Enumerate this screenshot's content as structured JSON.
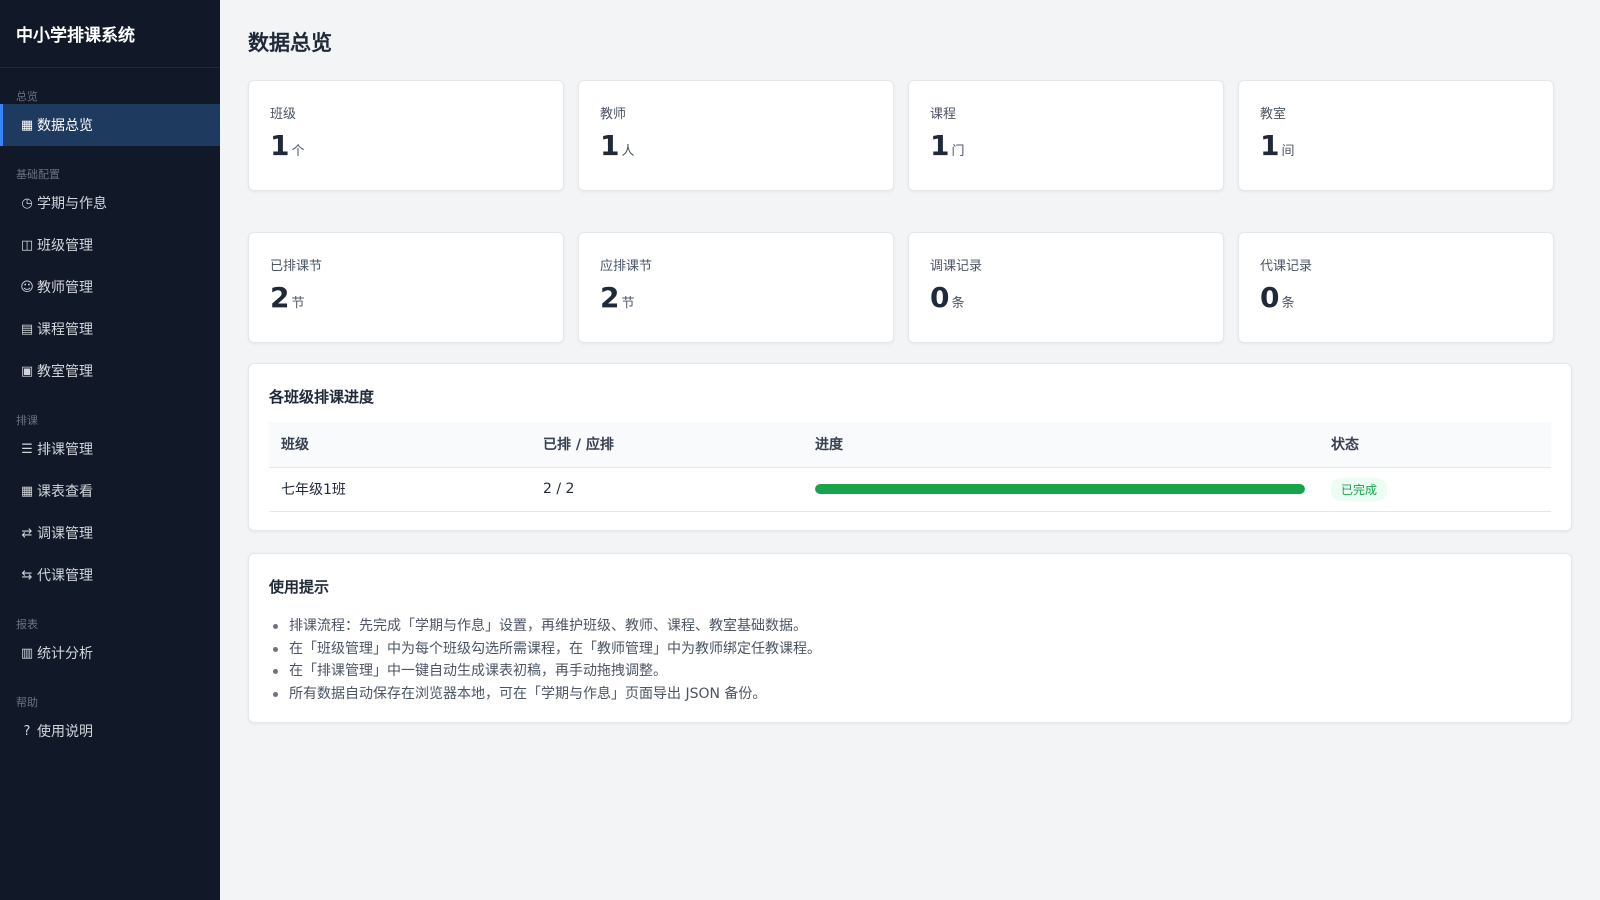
{
  "app": {
    "title": "中小学排课系统"
  },
  "sidebar": {
    "sections": [
      {
        "label": "总览",
        "items": [
          {
            "icon": "▦",
            "icon_name": "grid-icon",
            "label": "数据总览",
            "active": true
          }
        ]
      },
      {
        "label": "基础配置",
        "items": [
          {
            "icon": "◷",
            "icon_name": "clock-icon",
            "label": "学期与作息"
          },
          {
            "icon": "◫",
            "icon_name": "class-icon",
            "label": "班级管理"
          },
          {
            "icon": "☺",
            "icon_name": "teacher-icon",
            "label": "教师管理"
          },
          {
            "icon": "▤",
            "icon_name": "course-icon",
            "label": "课程管理"
          },
          {
            "icon": "▣",
            "icon_name": "classroom-icon",
            "label": "教室管理"
          }
        ]
      },
      {
        "label": "排课",
        "items": [
          {
            "icon": "☰",
            "icon_name": "list-icon",
            "label": "排课管理"
          },
          {
            "icon": "▦",
            "icon_name": "timetable-icon",
            "label": "课表查看"
          },
          {
            "icon": "⇄",
            "icon_name": "swap-icon",
            "label": "调课管理"
          },
          {
            "icon": "⇆",
            "icon_name": "substitute-icon",
            "label": "代课管理"
          }
        ]
      },
      {
        "label": "报表",
        "items": [
          {
            "icon": "▥",
            "icon_name": "chart-icon",
            "label": "统计分析"
          }
        ]
      },
      {
        "label": "帮助",
        "items": [
          {
            "icon": "?",
            "icon_name": "help-icon",
            "label": "使用说明"
          }
        ]
      }
    ]
  },
  "main": {
    "title": "数据总览",
    "stats": [
      {
        "label": "班级",
        "value": "1",
        "unit": "个"
      },
      {
        "label": "教师",
        "value": "1",
        "unit": "人"
      },
      {
        "label": "课程",
        "value": "1",
        "unit": "门"
      },
      {
        "label": "教室",
        "value": "1",
        "unit": "间"
      },
      {
        "label": "已排课节",
        "value": "2",
        "unit": "节"
      },
      {
        "label": "应排课节",
        "value": "2",
        "unit": "节"
      },
      {
        "label": "调课记录",
        "value": "0",
        "unit": "条"
      },
      {
        "label": "代课记录",
        "value": "0",
        "unit": "条"
      }
    ],
    "progress_panel": {
      "title": "各班级排课进度",
      "columns": [
        "班级",
        "已排 / 应排",
        "进度",
        "状态"
      ],
      "rows": [
        {
          "class": "七年级1班",
          "ratio": "2 / 2",
          "progress": 1.0,
          "status": "已完成"
        }
      ]
    },
    "tips_panel": {
      "title": "使用提示",
      "items": [
        "排课流程：先完成「学期与作息」设置，再维护班级、教师、课程、教室基础数据。",
        "在「班级管理」中为每个班级勾选所需课程，在「教师管理」中为教师绑定任教课程。",
        "在「排课管理」中一键自动生成课表初稿，再手动拖拽调整。",
        "所有数据自动保存在浏览器本地，可在「学期与作息」页面导出 JSON 备份。"
      ]
    }
  },
  "colors": {
    "sidebar_bg": "#111827",
    "accent": "#3b82f6",
    "success": "#16a34a"
  }
}
